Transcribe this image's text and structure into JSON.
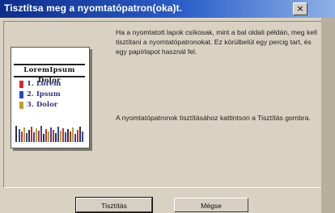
{
  "window": {
    "title": "Tisztítsa meg a nyomtatópatron(oka)t.",
    "close_glyph": "×"
  },
  "instructions": {
    "paragraph1": "Ha a nyomtatott lapok csíkosak, mint a bal oldali példán, meg kell tisztítani a nyomtatópatronokat.  Ez körülbelül egy percig tart, és egy papírlapot használ fel.",
    "paragraph2": "A nyomtatópatronok tisztításához kattintson a Tisztítás gombra."
  },
  "illustration": {
    "heading": "LoremIpsum Dolor",
    "items": [
      "1. Lorem",
      "2. Ipsum",
      "3. Dolor"
    ],
    "bullet_colors": [
      "#d22a2a",
      "#2747b8",
      "#b6a32a"
    ]
  },
  "buttons": {
    "clean_label": "Tisztítás",
    "cancel_label": "Mégse"
  }
}
